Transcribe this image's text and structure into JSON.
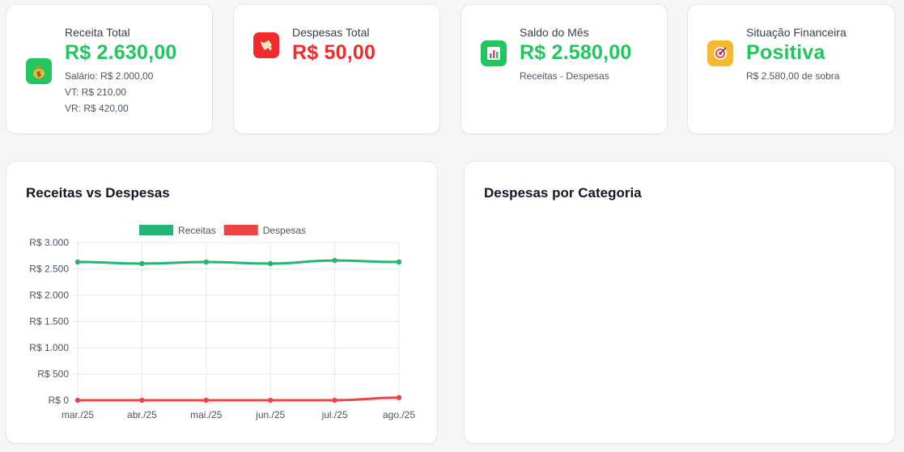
{
  "colors": {
    "positive": "#22c55e",
    "negative": "#ef2b2d",
    "line_income": "#22b573",
    "line_expense": "#ef4444"
  },
  "cards": {
    "receita": {
      "icon": "money-bag-icon",
      "label": "Receita Total",
      "value": "R$ 2.630,00",
      "lines": [
        "Salário: R$ 2.000,00",
        "VT: R$ 210,00",
        "VR: R$ 420,00"
      ]
    },
    "despesas": {
      "icon": "money-wings-icon",
      "label": "Despesas Total",
      "value": "R$ 50,00"
    },
    "saldo": {
      "icon": "bar-chart-icon",
      "label": "Saldo do Mês",
      "value": "R$ 2.580,00",
      "note": "Receitas - Despesas"
    },
    "situacao": {
      "icon": "target-icon",
      "label": "Situação Financeira",
      "value": "Positiva",
      "note": "R$ 2.580,00 de sobra"
    }
  },
  "panels": {
    "line_title": "Receitas vs Despesas",
    "category_title": "Despesas por Categoria"
  },
  "chart_data": {
    "type": "line",
    "categories": [
      "mar./25",
      "abr./25",
      "mai./25",
      "jun./25",
      "jul./25",
      "ago./25"
    ],
    "series": [
      {
        "name": "Receitas",
        "color": "#22b573",
        "values": [
          2630,
          2600,
          2630,
          2600,
          2660,
          2630
        ]
      },
      {
        "name": "Despesas",
        "color": "#ef4444",
        "values": [
          0,
          0,
          0,
          0,
          0,
          50
        ]
      }
    ],
    "ylim": [
      0,
      3000
    ],
    "yticks": [
      "R$ 0",
      "R$ 500",
      "R$ 1.000",
      "R$ 1.500",
      "R$ 2.000",
      "R$ 2.500",
      "R$ 3.000"
    ],
    "ytick_values": [
      0,
      500,
      1000,
      1500,
      2000,
      2500,
      3000
    ],
    "legend": "top-center",
    "grid": true
  }
}
